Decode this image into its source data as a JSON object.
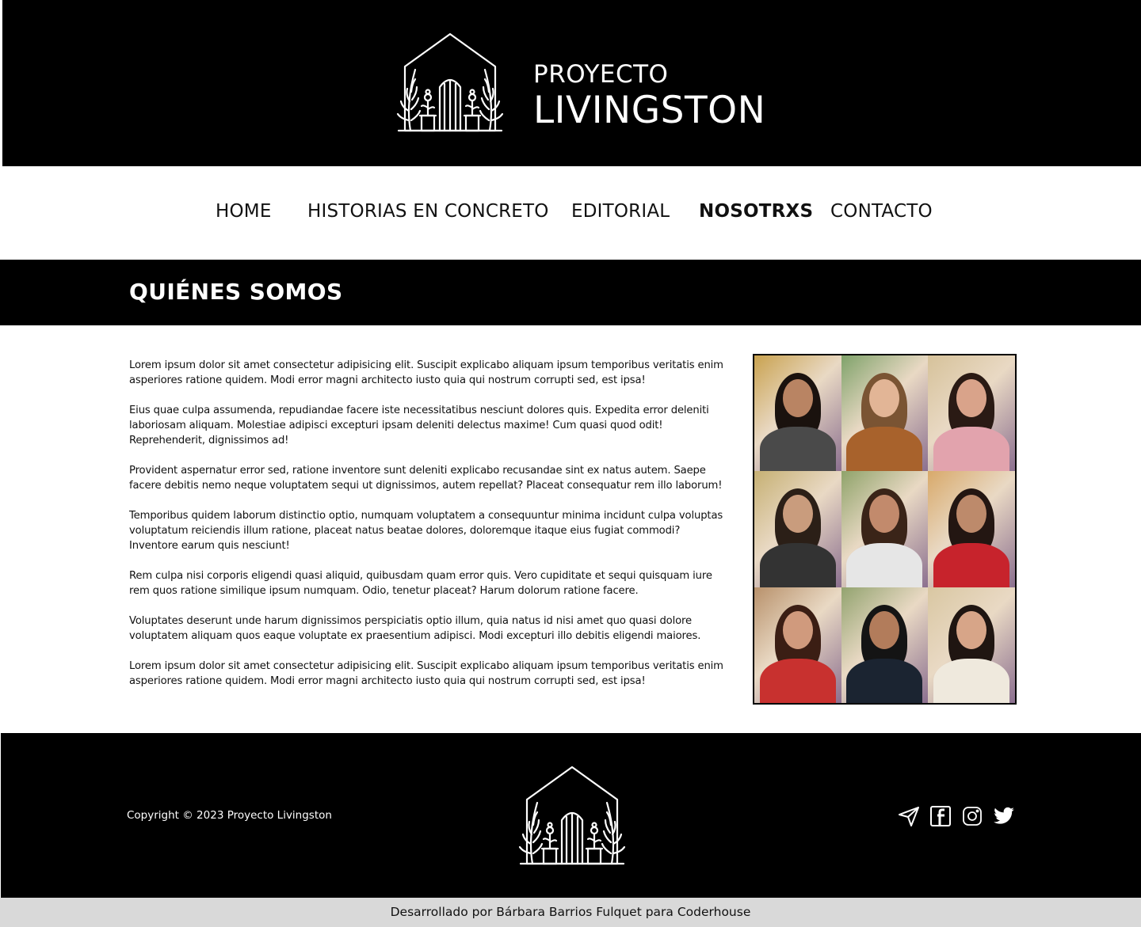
{
  "header": {
    "brand_top": "PROYECTO",
    "brand_bottom": "LIVINGSTON",
    "logo_icon": "house-garden-logo-icon"
  },
  "nav": {
    "items": [
      {
        "label": "HOME",
        "active": false
      },
      {
        "label": "HISTORIAS EN CONCRETO",
        "active": false
      },
      {
        "label": "EDITORIAL",
        "active": false
      },
      {
        "label": "NOSOTRXS",
        "active": true
      },
      {
        "label": "CONTACTO",
        "active": false
      }
    ]
  },
  "section": {
    "title": "QUIÉNES SOMOS"
  },
  "content": {
    "paragraphs": [
      "Lorem ipsum dolor sit amet consectetur adipisicing elit. Suscipit explicabo aliquam ipsum temporibus veritatis enim asperiores ratione quidem. Modi error magni architecto iusto quia qui nostrum corrupti sed, est ipsa!",
      "Eius quae culpa assumenda, repudiandae facere iste necessitatibus nesciunt dolores quis. Expedita error deleniti laboriosam aliquam. Molestiae adipisci excepturi ipsam deleniti delectus maxime! Cum quasi quod odit! Reprehenderit, dignissimos ad!",
      "Provident aspernatur error sed, ratione inventore sunt deleniti explicabo recusandae sint ex natus autem. Saepe facere debitis nemo neque voluptatem sequi ut dignissimos, autem repellat? Placeat consequatur rem illo laborum!",
      "Temporibus quidem laborum distinctio optio, numquam voluptatem a consequuntur minima incidunt culpa voluptas voluptatum reiciendis illum ratione, placeat natus beatae dolores, doloremque itaque eius fugiat commodi? Inventore earum quis nesciunt!",
      "Rem culpa nisi corporis eligendi quasi aliquid, quibusdam quam error quis. Vero cupiditate et sequi quisquam iure rem quos ratione similique ipsum numquam. Odio, tenetur placeat? Harum dolorum ratione facere.",
      "Voluptates deserunt unde harum dignissimos perspiciatis optio illum, quia natus id nisi amet quo quasi dolore voluptatem aliquam quos eaque voluptate ex praesentium adipisci. Modi excepturi illo debitis eligendi maiores.",
      "Lorem ipsum dolor sit amet consectetur adipisicing elit. Suscipit explicabo aliquam ipsum temporibus veritatis enim asperiores ratione quidem. Modi error magni architecto iusto quia qui nostrum corrupti sed, est ipsa!"
    ],
    "team_photo": {
      "people": [
        {
          "hair": "#1a120e",
          "skin": "#b98463",
          "top": "#4a4a4a",
          "bg": "#c9a24f"
        },
        {
          "hair": "#7a5433",
          "skin": "#e2b596",
          "top": "#a8622c",
          "bg": "#7fa26a"
        },
        {
          "hair": "#2a1a14",
          "skin": "#d9a38a",
          "top": "#e2a3ad",
          "bg": "#d6c29a"
        },
        {
          "hair": "#2b1f17",
          "skin": "#c99c7d",
          "top": "#333333",
          "bg": "#c6b073"
        },
        {
          "hair": "#3a2418",
          "skin": "#c28a6c",
          "top": "#e6e6e6",
          "bg": "#8fa36a"
        },
        {
          "hair": "#231612",
          "skin": "#bd8a6b",
          "top": "#c7232c",
          "bg": "#d8a96a"
        },
        {
          "hair": "#3b1e14",
          "skin": "#d09a7d",
          "top": "#c8312f",
          "bg": "#b8916b"
        },
        {
          "hair": "#141414",
          "skin": "#b27c5b",
          "top": "#1b2431",
          "bg": "#92a36f"
        },
        {
          "hair": "#1f1511",
          "skin": "#d7a588",
          "top": "#efe9dd",
          "bg": "#d9c7a2"
        }
      ]
    }
  },
  "footer": {
    "copyright": "Copyright © 2023 Proyecto Livingston",
    "logo_icon": "house-garden-logo-icon",
    "social_icons": [
      "send-icon",
      "facebook-icon",
      "instagram-icon",
      "twitter-icon"
    ]
  },
  "credits": {
    "text": "Desarrollado por Bárbara Barrios Fulquet para Coderhouse"
  },
  "colors": {
    "header_bg": "#000000",
    "banner_bg": "#000000",
    "footer_bg": "#000000",
    "credits_bg": "#d9d9d9",
    "text": "#111111"
  }
}
